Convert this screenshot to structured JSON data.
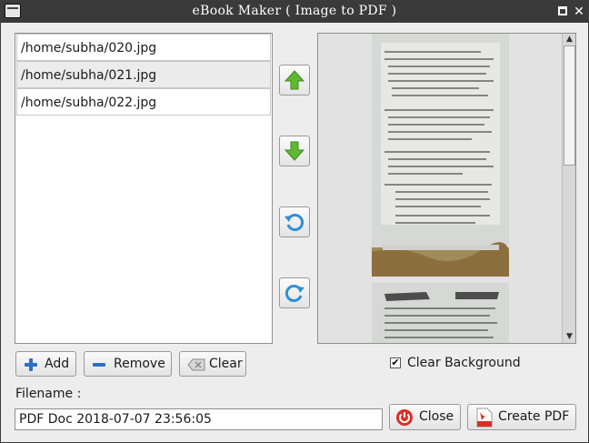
{
  "window": {
    "title": "eBook Maker ( Image to PDF )",
    "close_glyph": "✕"
  },
  "files": [
    {
      "path": "/home/subha/020.jpg"
    },
    {
      "path": "/home/subha/021.jpg"
    },
    {
      "path": "/home/subha/022.jpg"
    }
  ],
  "toolbar": {
    "add_label": "Add",
    "remove_label": "Remove",
    "clear_label": "Clear"
  },
  "options": {
    "clear_background_label": "Clear Background",
    "clear_background_checked": true,
    "check_glyph": "✔"
  },
  "filename": {
    "label": "Filename :",
    "value": "PDF Doc 2018-07-07 23:56:05"
  },
  "actions": {
    "close_label": "Close",
    "create_label": "Create PDF"
  },
  "colors": {
    "arrow_green": "#5fb832",
    "rotate_blue": "#2f8fd8",
    "close_red": "#d93025",
    "titlebar": "#3a3a3a"
  }
}
